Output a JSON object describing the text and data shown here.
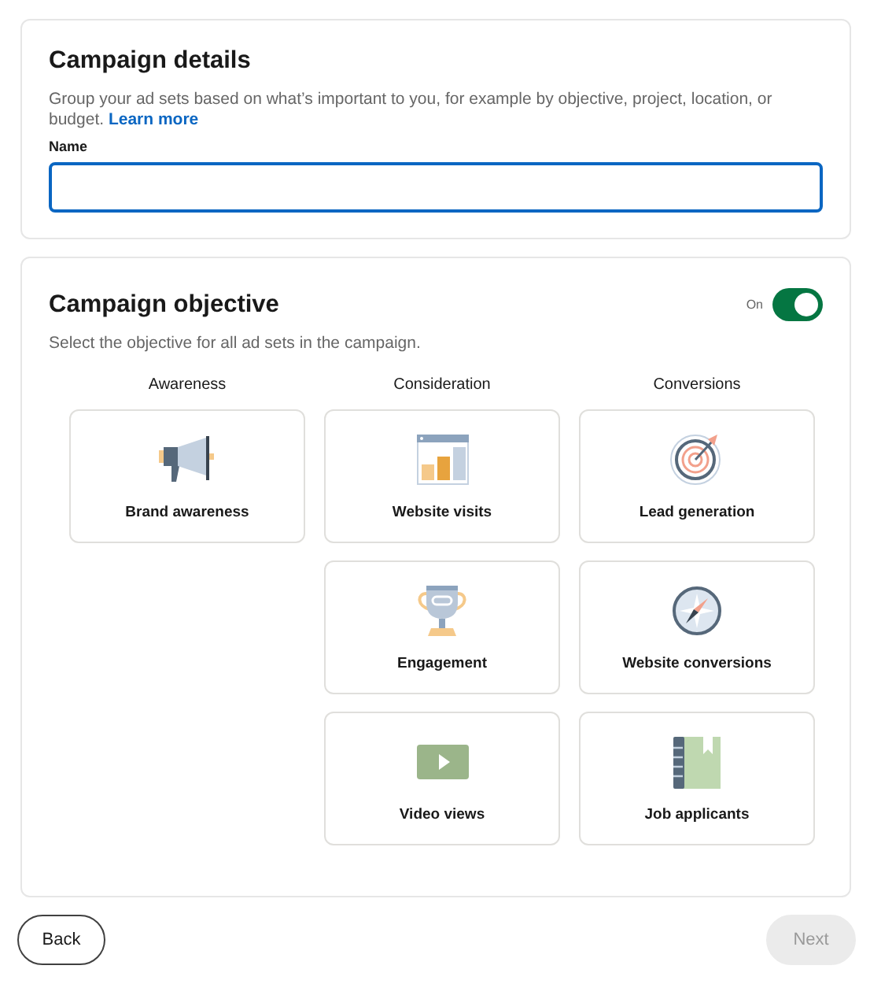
{
  "details": {
    "title": "Campaign details",
    "description": "Group your ad sets based on what’s important to you, for example by objective, project, location, or budget.",
    "link": "Learn more",
    "field": {
      "label": "Name"
    }
  },
  "objective": {
    "title": "Campaign objective",
    "toggle": {
      "label": "On",
      "on": true
    },
    "description": "Select the objective for all ad sets in the campaign.",
    "columns": [
      {
        "heading": "Awareness",
        "items": [
          {
            "label": "Brand awareness",
            "selected": false
          }
        ]
      },
      {
        "heading": "Consideration",
        "items": [
          {
            "label": "Website visits",
            "selected": false
          },
          {
            "label": "Engagement",
            "selected": false
          },
          {
            "label": "Video views",
            "selected": false
          }
        ]
      },
      {
        "heading": "Conversions",
        "items": [
          {
            "label": "Lead generation",
            "selected": false
          },
          {
            "label": "Website conversions",
            "selected": false
          },
          {
            "label": "Job applicants",
            "selected": false
          }
        ]
      }
    ]
  },
  "footer": {
    "back": {
      "label": "Back",
      "disabled": false
    },
    "next": {
      "label": "Next",
      "disabled": true
    }
  }
}
